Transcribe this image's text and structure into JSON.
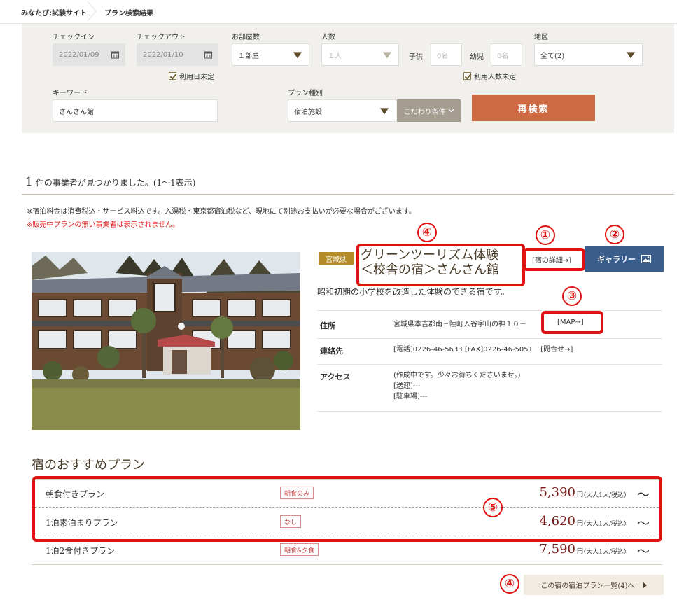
{
  "breadcrumb": {
    "site": "みなたび:試験サイト",
    "current": "プラン検索結果"
  },
  "search": {
    "checkin_label": "チェックイン",
    "checkin_value": "2022/01/09",
    "checkout_label": "チェックアウト",
    "checkout_value": "2022/01/10",
    "rooms_label": "お部屋数",
    "rooms_value": "１部屋",
    "people_label": "人数",
    "people_value": "１人",
    "child_label": "子供",
    "child_value": "0名",
    "infant_label": "幼児",
    "infant_value": "0名",
    "area_label": "地区",
    "area_value": "全て(2)",
    "date_undecided": "利用日未定",
    "people_undecided": "利用人数未定",
    "keyword_label": "キーワード",
    "keyword_value": "さんさん館",
    "plan_type_label": "プラン種別",
    "plan_type_value": "宿泊施設",
    "kodawari_label": "こだわり条件",
    "research_button": "再検索"
  },
  "results": {
    "count": "1",
    "count_text": "件の事業者が見つかりました。(1〜1表示)",
    "note_tax": "※宿泊料金は消費税込・サービス料込です。入湯税・東京都宿泊税など、現地にて別途お支払いが必要な場合がございます。",
    "note_hidden": "※販売中プランの無い事業者は表示されません。"
  },
  "hotel": {
    "prefecture": "宮城県",
    "name_line1": "グリーンツーリズム体験",
    "name_line2": "＜校舎の宿＞さんさん館",
    "details_link": "[宿の詳細→]",
    "gallery_button": "ギャラリー",
    "description": "昭和初期の小学校を改造した体験のできる宿です。",
    "address_label": "住所",
    "address_value": "宮城県本吉郡南三陸町入谷字山の神１０－",
    "map_link": "[MAP→]",
    "contact_label": "連絡先",
    "contact_value": "[電話]0226-46-5633 [FAX]0226-46-5051",
    "inquiry_link": "[問合せ→]",
    "access_label": "アクセス",
    "access_line1": "(作成中です。少々お待ちくださいませ。)",
    "access_line2": "[送迎]---",
    "access_line3": "[駐車場]---"
  },
  "plans": {
    "title": "宿のおすすめプラン",
    "items": [
      {
        "name": "朝食付きプラン",
        "tag": "朝食のみ",
        "price": "5,390",
        "unit": "円",
        "per": "（大人1人/税込）",
        "tilde": "〜"
      },
      {
        "name": "1泊素泊まりプラン",
        "tag": "なし",
        "price": "4,620",
        "unit": "円",
        "per": "（大人1人/税込）",
        "tilde": "〜"
      },
      {
        "name": "1泊2食付きプラン",
        "tag": "朝食&夕食",
        "price": "7,590",
        "unit": "円",
        "per": "（大人1人/税込）",
        "tilde": "〜"
      }
    ],
    "list_button": "この宿の宿泊プラン一覧(4)へ"
  },
  "annotations": {
    "n1": "①",
    "n2": "②",
    "n3": "③",
    "n4": "④",
    "n5": "⑤",
    "n4b": "④"
  },
  "colors": {
    "accent_button": "#cd6a44",
    "gallery_button": "#3b5d8c",
    "prefecture_badge": "#b58c2a",
    "annotation_red": "#e01111"
  }
}
